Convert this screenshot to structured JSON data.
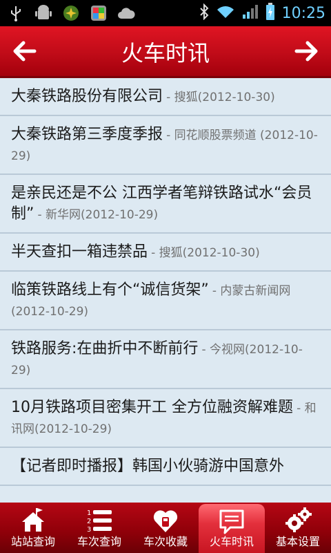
{
  "status_bar": {
    "time": "10:25"
  },
  "header": {
    "title": "火车时讯"
  },
  "news": [
    {
      "title": "大秦铁路股份有限公司",
      "meta": "- 搜狐(2012-10-30)"
    },
    {
      "title": "大秦铁路第三季度季报",
      "meta": "- 同花顺股票频道 (2012-10-29)"
    },
    {
      "title": "是亲民还是不公 江西学者笔辩铁路试水“会员制”",
      "meta": "- 新华网(2012-10-29)"
    },
    {
      "title": "半天查扣一箱违禁品",
      "meta": "- 搜狐(2012-10-30)"
    },
    {
      "title": "临策铁路线上有个“诚信货架”",
      "meta": "- 内蒙古新闻网 (2012-10-29)"
    },
    {
      "title": "铁路服务:在曲折中不断前行",
      "meta": "- 今视网(2012-10-29)"
    },
    {
      "title": "10月铁路项目密集开工 全方位融资解难题",
      "meta": "- 和讯网(2012-10-29)"
    },
    {
      "title": "【记者即时播报】韩国小伙骑游中国意外",
      "meta": ""
    }
  ],
  "tabs": [
    {
      "label": "站站查询",
      "icon": "house-flag-icon"
    },
    {
      "label": "车次查询",
      "icon": "numbered-list-icon"
    },
    {
      "label": "车次收藏",
      "icon": "heart-icon"
    },
    {
      "label": "火车时讯",
      "icon": "message-icon"
    },
    {
      "label": "基本设置",
      "icon": "gears-icon"
    }
  ],
  "active_tab": "火车时讯",
  "colors": {
    "accent": "#c00b18",
    "list_bg": "#dde9f2",
    "time": "#6fd0ff"
  }
}
